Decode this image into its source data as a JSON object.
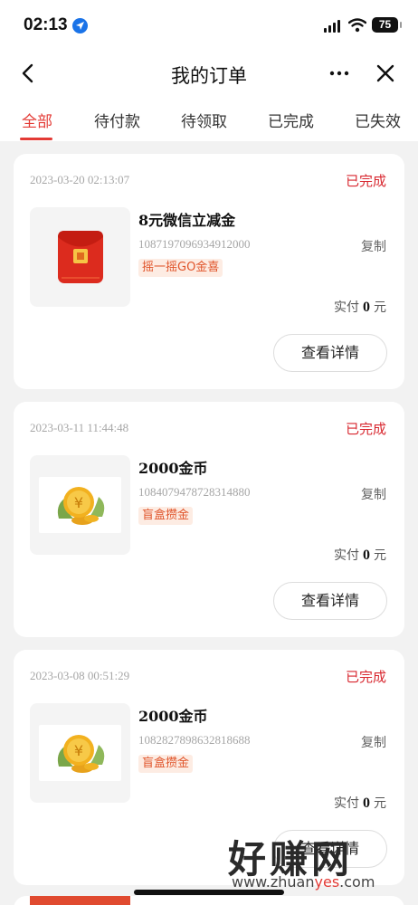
{
  "status_bar": {
    "time": "02:13",
    "battery": "75"
  },
  "header": {
    "title": "我的订单"
  },
  "tabs": [
    {
      "label": "全部",
      "active": true
    },
    {
      "label": "待付款"
    },
    {
      "label": "待领取"
    },
    {
      "label": "已完成"
    },
    {
      "label": "已失效"
    }
  ],
  "orders": [
    {
      "time": "2023-03-20 02:13:07",
      "status": "已完成",
      "name": "8元微信立减金",
      "code": "1087197096934912000",
      "copy": "复制",
      "tag": "摇一摇GO金喜",
      "paid_label": "实付",
      "amount": "0",
      "currency": "元",
      "detail_button": "查看详情",
      "image": "red-envelope-icon"
    },
    {
      "time": "2023-03-11 11:44:48",
      "status": "已完成",
      "name": "2000金币",
      "code": "1084079478728314880",
      "copy": "复制",
      "tag": "盲盒攒金",
      "paid_label": "实付",
      "amount": "0",
      "currency": "元",
      "detail_button": "查看详情",
      "image": "gold-coin-icon"
    },
    {
      "time": "2023-03-08 00:51:29",
      "status": "已完成",
      "name": "2000金币",
      "code": "1082827898632818688",
      "copy": "复制",
      "tag": "盲盒攒金",
      "paid_label": "实付",
      "amount": "0",
      "currency": "元",
      "detail_button": "查看详情",
      "image": "gold-coin-icon"
    }
  ],
  "watermark": {
    "title": "好赚网",
    "url_prefix": "www.zhuan",
    "url_accent": "yes",
    "url_suffix": ".com"
  },
  "colors": {
    "accent": "#e33a35",
    "tag_text": "#e0542a",
    "tag_bg": "#fdece3"
  }
}
